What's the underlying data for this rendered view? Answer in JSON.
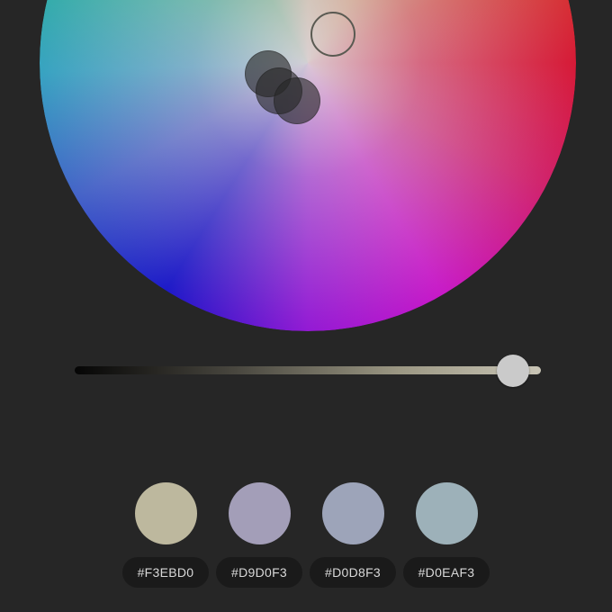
{
  "color_picker": {
    "wheel": {
      "selected_handle_icon": "ring-handle-icon",
      "harmony_handle_icon": "circle-handle-icon"
    },
    "brightness_slider": {
      "value": 0.94,
      "gradient_start": "#050505",
      "gradient_end": "#c9c5b6"
    },
    "swatches": [
      {
        "label": "#F3EBD0",
        "display_color": "#bdb89e"
      },
      {
        "label": "#D9D0F3",
        "display_color": "#a39eb8"
      },
      {
        "label": "#D0D8F3",
        "display_color": "#9da4b9"
      },
      {
        "label": "#D0EAF3",
        "display_color": "#9db1b9"
      }
    ]
  }
}
